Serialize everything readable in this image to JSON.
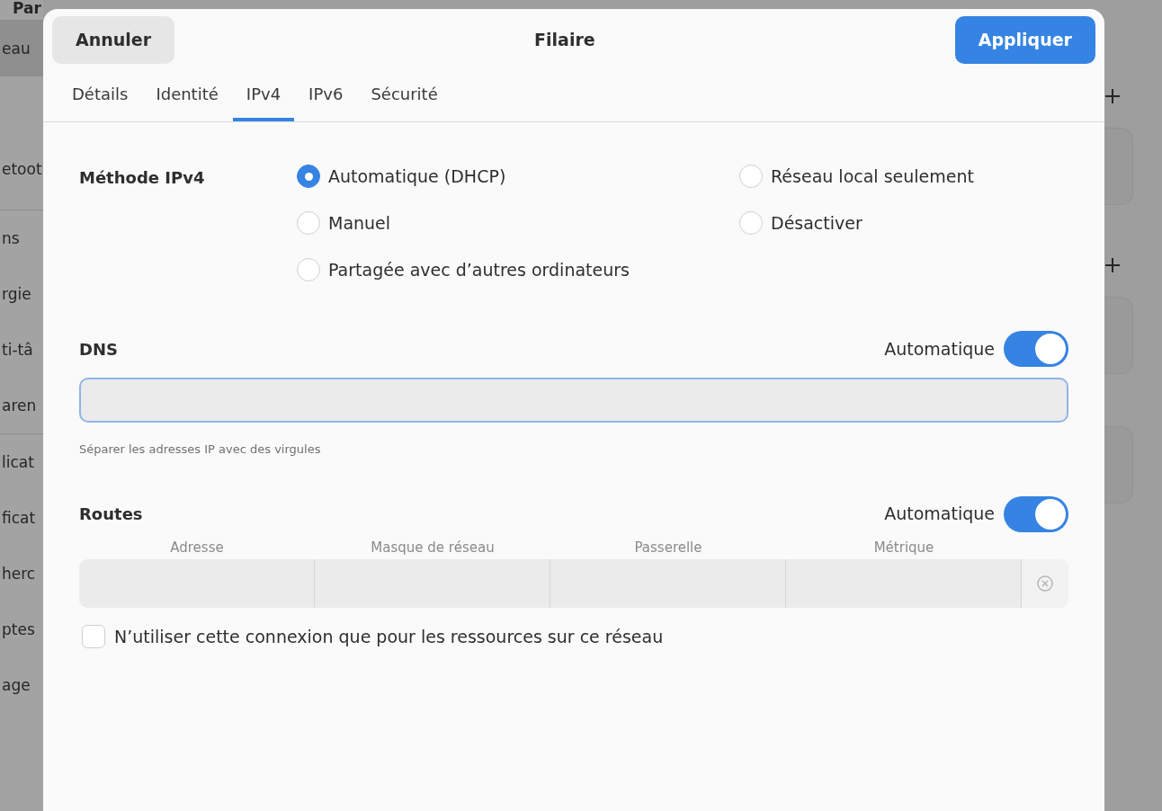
{
  "background": {
    "sidebar_title": "Par",
    "sidebar_groups": [
      {
        "items": [
          {
            "label": "eau",
            "selected": true
          },
          {
            "label": "etoot",
            "selected": false
          }
        ]
      },
      {
        "items": [
          {
            "label": "ns",
            "selected": false
          },
          {
            "label": "rgie",
            "selected": false
          },
          {
            "label": "ti-tâ",
            "selected": false
          },
          {
            "label": "aren",
            "selected": false
          }
        ]
      },
      {
        "items": [
          {
            "label": "licat",
            "selected": false
          },
          {
            "label": "ficat",
            "selected": false
          },
          {
            "label": "herc",
            "selected": false
          },
          {
            "label": "ptes",
            "selected": false
          },
          {
            "label": "age",
            "selected": false
          }
        ]
      }
    ]
  },
  "dialog": {
    "title": "Filaire",
    "cancel_button": "Annuler",
    "apply_button": "Appliquer",
    "tabs": [
      {
        "label": "Détails",
        "selected": false
      },
      {
        "label": "Identité",
        "selected": false
      },
      {
        "label": "IPv4",
        "selected": true
      },
      {
        "label": "IPv6",
        "selected": false
      },
      {
        "label": "Sécurité",
        "selected": false
      }
    ],
    "method": {
      "label": "Méthode IPv4",
      "options": [
        {
          "label": "Automatique (DHCP)",
          "selected": true
        },
        {
          "label": "Réseau local seulement",
          "selected": false
        },
        {
          "label": "Manuel",
          "selected": false
        },
        {
          "label": "Désactiver",
          "selected": false
        },
        {
          "label": "Partagée avec d’autres ordinateurs",
          "selected": false
        }
      ]
    },
    "dns": {
      "label": "DNS",
      "auto_label": "Automatique",
      "auto_on": true,
      "hint": "Séparer les adresses IP avec des virgules"
    },
    "routes": {
      "label": "Routes",
      "auto_label": "Automatique",
      "auto_on": true,
      "columns": [
        "Adresse",
        "Masque de réseau",
        "Passerelle",
        "Métrique"
      ]
    },
    "local_only": {
      "label": "N’utiliser cette connexion que pour les ressources sur ce réseau",
      "checked": false
    }
  }
}
